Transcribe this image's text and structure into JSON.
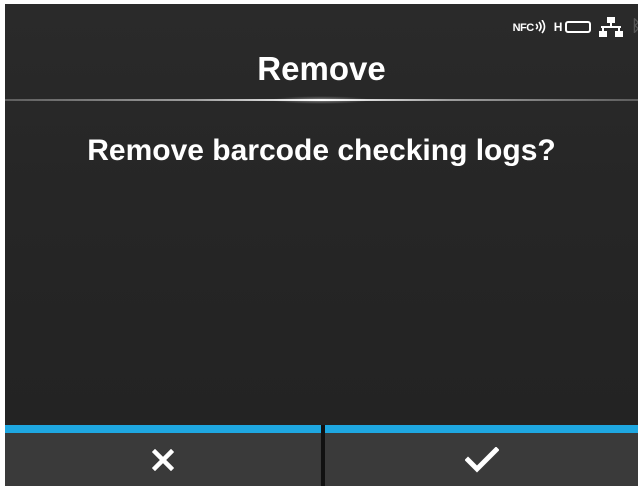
{
  "status_bar": {
    "nfc_label": "NFC",
    "battery_label": "H"
  },
  "dialog": {
    "title": "Remove",
    "message": "Remove barcode checking logs?"
  },
  "buttons": {
    "cancel_icon": "close-icon",
    "confirm_icon": "check-icon"
  },
  "colors": {
    "accent": "#1ea7e1",
    "background": "#262626",
    "button_background": "#3a3a3a",
    "text": "#ffffff"
  }
}
